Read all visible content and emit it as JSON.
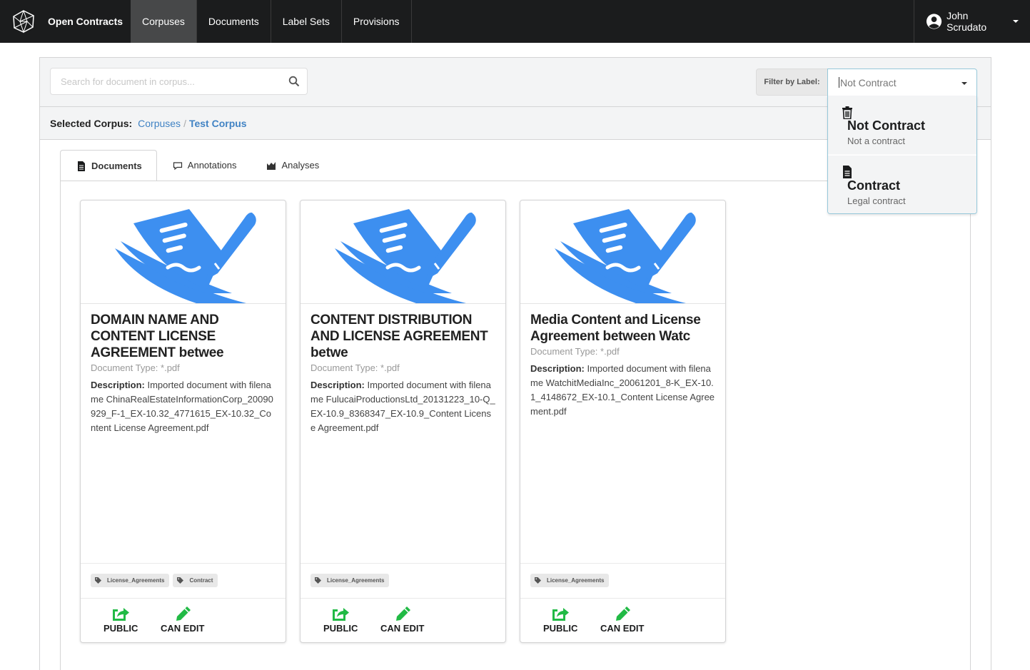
{
  "navbar": {
    "brand": "Open Contracts",
    "items": [
      "Corpuses",
      "Documents",
      "Label Sets",
      "Provisions"
    ],
    "active_item": "Corpuses",
    "user_name": "John Scrudato"
  },
  "search": {
    "placeholder": "Search for document in corpus..."
  },
  "filter": {
    "label": "Filter by Label:",
    "selected": "Not Contract",
    "options": [
      {
        "icon": "trash-icon",
        "title": "Not Contract",
        "description": "Not a contract"
      },
      {
        "icon": "file-icon",
        "title": "Contract",
        "description": "Legal contract"
      }
    ]
  },
  "corpus": {
    "title": "Selected Corpus:",
    "breadcrumb": [
      "Corpuses",
      "Test Corpus"
    ]
  },
  "tabs": [
    "Documents",
    "Annotations",
    "Analyses"
  ],
  "active_tab": "Documents",
  "documents": [
    {
      "title": "DOMAIN NAME AND CONTENT LICENSE AGREEMENT betwee",
      "doc_type": "Document Type: *.pdf",
      "description_label": "Description:",
      "description": "Imported document with filename ChinaRealEstateInformationCorp_20090929_F-1_EX-10.32_4771615_EX-10.32_Content License Agreement.pdf",
      "labels": [
        "License_Agreements",
        "Contract"
      ],
      "footer": [
        "PUBLIC",
        "CAN EDIT"
      ]
    },
    {
      "title": "CONTENT DISTRIBUTION AND LICENSE AGREEMENT betwe",
      "doc_type": "Document Type: *.pdf",
      "description_label": "Description:",
      "description": "Imported document with filename FulucaiProductionsLtd_20131223_10-Q_EX-10.9_8368347_EX-10.9_Content License Agreement.pdf",
      "labels": [
        "License_Agreements"
      ],
      "footer": [
        "PUBLIC",
        "CAN EDIT"
      ]
    },
    {
      "title": "Media Content and License Agreement between Watc",
      "doc_type": "Document Type: *.pdf",
      "description_label": "Description:",
      "description": "Imported document with filename WatchitMediaInc_20061201_8-K_EX-10.1_4148672_EX-10.1_Content License Agreement.pdf",
      "labels": [
        "License_Agreements"
      ],
      "footer": [
        "PUBLIC",
        "CAN EDIT"
      ]
    }
  ],
  "colors": {
    "navbar_bg": "#1b1c1d",
    "link": "#4183c4",
    "doc_icon_blue": "#3d8ff0",
    "permission_green": "#21ba45"
  }
}
